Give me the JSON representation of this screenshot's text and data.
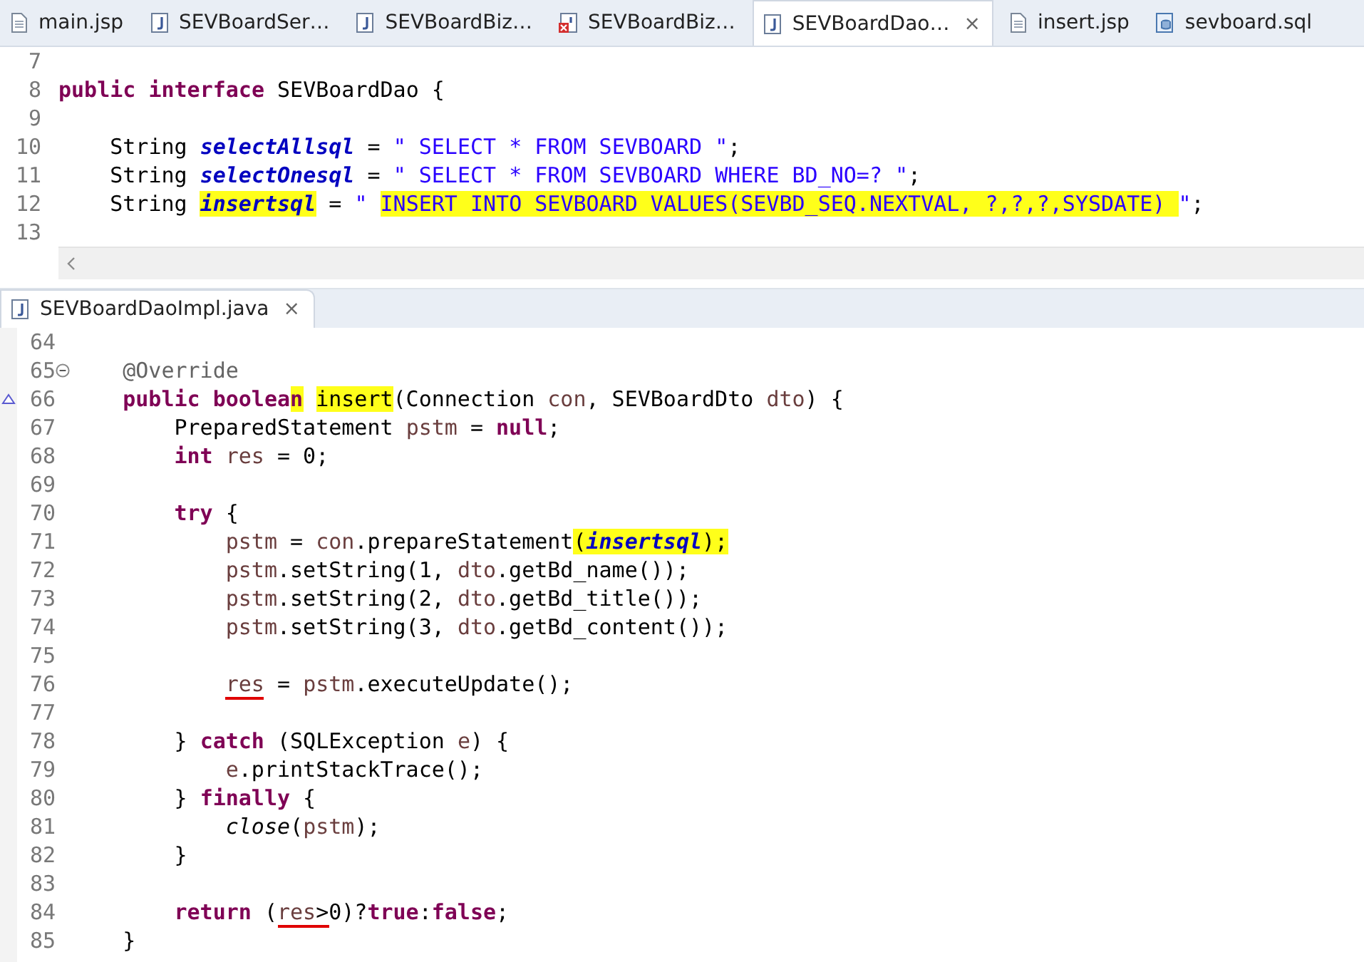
{
  "editor_tabs": [
    {
      "label": "main.jsp",
      "kind": "jsp",
      "selected": false
    },
    {
      "label": "SEVBoardSer…",
      "kind": "java",
      "selected": false
    },
    {
      "label": "SEVBoardBiz…",
      "kind": "java",
      "selected": false
    },
    {
      "label": "SEVBoardBiz…",
      "kind": "error",
      "selected": false
    },
    {
      "label": "SEVBoardDao…",
      "kind": "java",
      "selected": true,
      "close": "×"
    },
    {
      "label": "insert.jsp",
      "kind": "jsp",
      "selected": false
    },
    {
      "label": "sevboard.sql",
      "kind": "sql",
      "selected": false
    }
  ],
  "top_editor": {
    "lines": [
      {
        "number": "7"
      },
      {
        "number": "8",
        "tokens": [
          {
            "text": "public ",
            "kind": "keyword"
          },
          {
            "text": "interface",
            "kind": "keyword"
          },
          {
            "text": " SEVBoardDao {",
            "kind": "plain"
          }
        ]
      },
      {
        "number": "9"
      },
      {
        "number": "10",
        "tokens": [
          {
            "text": "    String ",
            "kind": "plain"
          },
          {
            "text": "selectAllsql",
            "kind": "field"
          },
          {
            "text": " = ",
            "kind": "plain"
          },
          {
            "text": "\" SELECT * FROM SEVBOARD \"",
            "kind": "string"
          },
          {
            "text": ";",
            "kind": "plain"
          }
        ]
      },
      {
        "number": "11",
        "tokens": [
          {
            "text": "    String ",
            "kind": "plain"
          },
          {
            "text": "selectOnesql",
            "kind": "field"
          },
          {
            "text": " = ",
            "kind": "plain"
          },
          {
            "text": "\" SELECT * FROM SEVBOARD WHERE BD_NO=? \"",
            "kind": "string"
          },
          {
            "text": ";",
            "kind": "plain"
          }
        ]
      },
      {
        "number": "12",
        "tokens": [
          {
            "text": "    String ",
            "kind": "plain"
          },
          {
            "text": "insertsql",
            "kind": "field",
            "highlighted": true
          },
          {
            "text": " = ",
            "kind": "plain"
          },
          {
            "text": "\" ",
            "kind": "string"
          },
          {
            "text": "INSERT INTO SEVBOARD VALUES(SEVBD_SEQ.NEXTVAL, ?,?,?,SYSDATE) ",
            "kind": "string",
            "highlighted": true
          },
          {
            "text": "\"",
            "kind": "string"
          },
          {
            "text": ";",
            "kind": "plain"
          }
        ]
      },
      {
        "number": "13"
      }
    ]
  },
  "bottom_tab": {
    "label": "SEVBoardDaoImpl.java",
    "kind": "java",
    "selected": true,
    "close": "×"
  },
  "bottom_editor": {
    "lines": [
      {
        "number": "64"
      },
      {
        "number": "65",
        "collapsible": true,
        "tokens": [
          {
            "text": "    @Override",
            "kind": "annotation"
          }
        ]
      },
      {
        "number": "66",
        "overrides": true,
        "tokens": [
          {
            "text": "    public ",
            "kind": "keyword"
          },
          {
            "text": "boolea",
            "kind": "keyword"
          },
          {
            "text": "n",
            "kind": "keyword",
            "highlighted": true
          },
          {
            "text": " insert",
            "kind": "plain",
            "highlighted": true
          },
          {
            "text": "(Connection ",
            "kind": "plain"
          },
          {
            "text": "con",
            "kind": "variable"
          },
          {
            "text": ", SEVBoardDto ",
            "kind": "plain"
          },
          {
            "text": "dto",
            "kind": "variable"
          },
          {
            "text": ") {",
            "kind": "plain"
          }
        ]
      },
      {
        "number": "67",
        "tokens": [
          {
            "text": "        PreparedStatement ",
            "kind": "plain"
          },
          {
            "text": "pstm",
            "kind": "variable"
          },
          {
            "text": " = ",
            "kind": "plain"
          },
          {
            "text": "null",
            "kind": "keyword"
          },
          {
            "text": ";",
            "kind": "plain"
          }
        ]
      },
      {
        "number": "68",
        "tokens": [
          {
            "text": "        int ",
            "kind": "keyword"
          },
          {
            "text": "res",
            "kind": "variable"
          },
          {
            "text": " = 0;",
            "kind": "plain"
          }
        ]
      },
      {
        "number": "69"
      },
      {
        "number": "70",
        "tokens": [
          {
            "text": "        try",
            "kind": "keyword"
          },
          {
            "text": " {",
            "kind": "plain"
          }
        ]
      },
      {
        "number": "71",
        "tokens": [
          {
            "text": "            pstm",
            "kind": "variable"
          },
          {
            "text": " = ",
            "kind": "plain"
          },
          {
            "text": "con",
            "kind": "variable"
          },
          {
            "text": ".prepareStatement",
            "kind": "plain"
          },
          {
            "text": "(",
            "kind": "plain",
            "highlighted": true
          },
          {
            "text": "insertsql",
            "kind": "field",
            "highlighted": true
          },
          {
            "text": ");",
            "kind": "plain",
            "highlighted": true
          }
        ]
      },
      {
        "number": "72",
        "tokens": [
          {
            "text": "            pstm",
            "kind": "variable"
          },
          {
            "text": ".setString(1, ",
            "kind": "plain"
          },
          {
            "text": "dto",
            "kind": "variable"
          },
          {
            "text": ".getBd_name());",
            "kind": "plain"
          }
        ]
      },
      {
        "number": "73",
        "tokens": [
          {
            "text": "            pstm",
            "kind": "variable"
          },
          {
            "text": ".setString(2, ",
            "kind": "plain"
          },
          {
            "text": "dto",
            "kind": "variable"
          },
          {
            "text": ".getBd_title());",
            "kind": "plain"
          }
        ]
      },
      {
        "number": "74",
        "tokens": [
          {
            "text": "            pstm",
            "kind": "variable"
          },
          {
            "text": ".setString(3, ",
            "kind": "plain"
          },
          {
            "text": "dto",
            "kind": "variable"
          },
          {
            "text": ".getBd_content());",
            "kind": "plain"
          }
        ]
      },
      {
        "number": "75"
      },
      {
        "number": "76",
        "tokens": [
          {
            "text": "            res",
            "kind": "variable",
            "underlined": true
          },
          {
            "text": " = ",
            "kind": "plain"
          },
          {
            "text": "pstm",
            "kind": "variable"
          },
          {
            "text": ".executeUpdate();",
            "kind": "plain"
          }
        ]
      },
      {
        "number": "77"
      },
      {
        "number": "78",
        "tokens": [
          {
            "text": "        } ",
            "kind": "plain"
          },
          {
            "text": "catch",
            "kind": "keyword"
          },
          {
            "text": " (SQLException ",
            "kind": "plain"
          },
          {
            "text": "e",
            "kind": "variable"
          },
          {
            "text": ") {",
            "kind": "plain"
          }
        ]
      },
      {
        "number": "79",
        "tokens": [
          {
            "text": "            e",
            "kind": "variable"
          },
          {
            "text": ".printStackTrace();",
            "kind": "plain"
          }
        ]
      },
      {
        "number": "80",
        "tokens": [
          {
            "text": "        } ",
            "kind": "plain"
          },
          {
            "text": "finally",
            "kind": "keyword"
          },
          {
            "text": " {",
            "kind": "plain"
          }
        ]
      },
      {
        "number": "81",
        "tokens": [
          {
            "text": "            close",
            "kind": "static"
          },
          {
            "text": "(",
            "kind": "plain"
          },
          {
            "text": "pstm",
            "kind": "variable"
          },
          {
            "text": ");",
            "kind": "plain"
          }
        ]
      },
      {
        "number": "82",
        "tokens": [
          {
            "text": "        }",
            "kind": "plain"
          }
        ]
      },
      {
        "number": "83"
      },
      {
        "number": "84",
        "tokens": [
          {
            "text": "        return",
            "kind": "keyword"
          },
          {
            "text": " (",
            "kind": "plain"
          },
          {
            "text": "res",
            "kind": "variable",
            "underlined": true
          },
          {
            "text": ">",
            "kind": "plain",
            "underlined": true
          },
          {
            "text": "0)?",
            "kind": "plain"
          },
          {
            "text": "true",
            "kind": "keyword"
          },
          {
            "text": ":",
            "kind": "plain"
          },
          {
            "text": "false",
            "kind": "keyword"
          },
          {
            "text": ";",
            "kind": "plain"
          }
        ]
      },
      {
        "number": "85",
        "tokens": [
          {
            "text": "    }",
            "kind": "plain"
          }
        ]
      }
    ]
  }
}
